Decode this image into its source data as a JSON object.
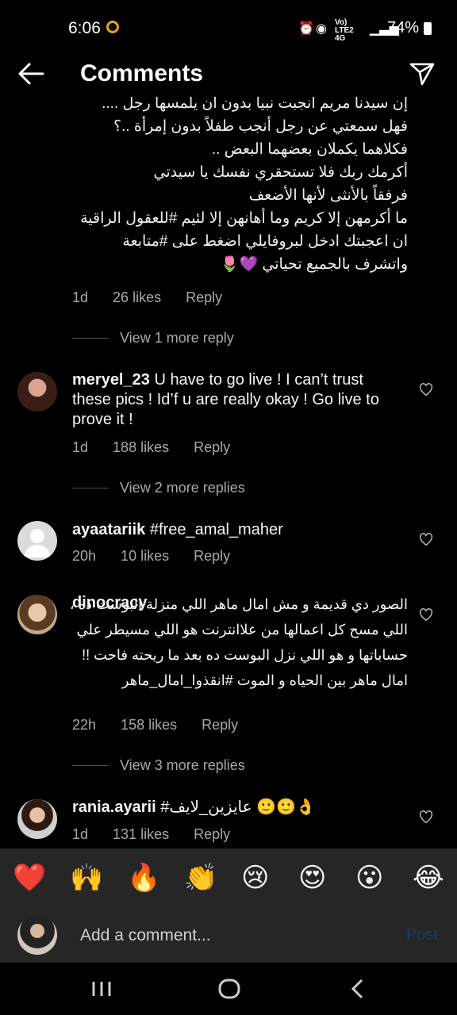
{
  "status_bar": {
    "time": "6:06",
    "network": "Vo) LTE2 4G",
    "battery": "74%"
  },
  "header": {
    "title": "Comments"
  },
  "caption": {
    "lines": [
      "إن سيدنا مريم أنجبت نبيا بدون أن يلمسها رجل ....",
      "فهل سمعتي عن رجل أنجب طفلاً بدون إمرأة ..؟",
      "فكلاهما يكملان بعضهما البعض ..",
      "أكرمك ربك فلا تستحقري نفسك يا سيدتي",
      "فرفقاً بالأنثى لأنها الأضعف",
      "ما أكرمهن إلا كريم وما أهانهن إلا لئيم #للعقول الراقية",
      "ان اعجبتك ادخل لبروفايلي اضغط على #متابعة",
      "واتشرف بالجميع تحياتي 💜🌷"
    ],
    "time": "1d",
    "likes": "26 likes",
    "reply": "Reply",
    "view_more": "View 1 more reply"
  },
  "comments": [
    {
      "username": "meryel_23",
      "text": "U have to go live ! I can’t trust these pics ! Id’f u are really okay ! Go live to prove it !",
      "time": "1d",
      "likes": "188 likes",
      "reply": "Reply",
      "view_more": "View 2 more replies"
    },
    {
      "username": "ayaatariik",
      "text": "#free_amal_maher",
      "time": "20h",
      "likes": "10 likes",
      "reply": "Reply"
    },
    {
      "username": "dinocracy",
      "text": "الصور دي قديمة و مش امال ماهر اللي منزلة البوست ده ، اللي مسح كل اعمالها من علاانترنت هو اللي مسيطر علي حساباتها و هو اللي نزل البوست ده بعد ما ريحته فاحت !! امال ماهر بين الحياه و الموت #انقذوا_امال_ماهر",
      "time": "22h",
      "likes": "158 likes",
      "reply": "Reply",
      "view_more": "View 3 more replies"
    },
    {
      "username": "rania.ayarii",
      "text": "#عايزين_لايف 🙂🙂👌",
      "time": "1d",
      "likes": "131 likes",
      "reply": "Reply"
    }
  ],
  "emoji_bar": [
    "❤️",
    "🙌",
    "🔥",
    "👏",
    "😢",
    "😍",
    "😮",
    "😂"
  ],
  "comment_input": {
    "placeholder": "Add a comment...",
    "post": "Post"
  }
}
